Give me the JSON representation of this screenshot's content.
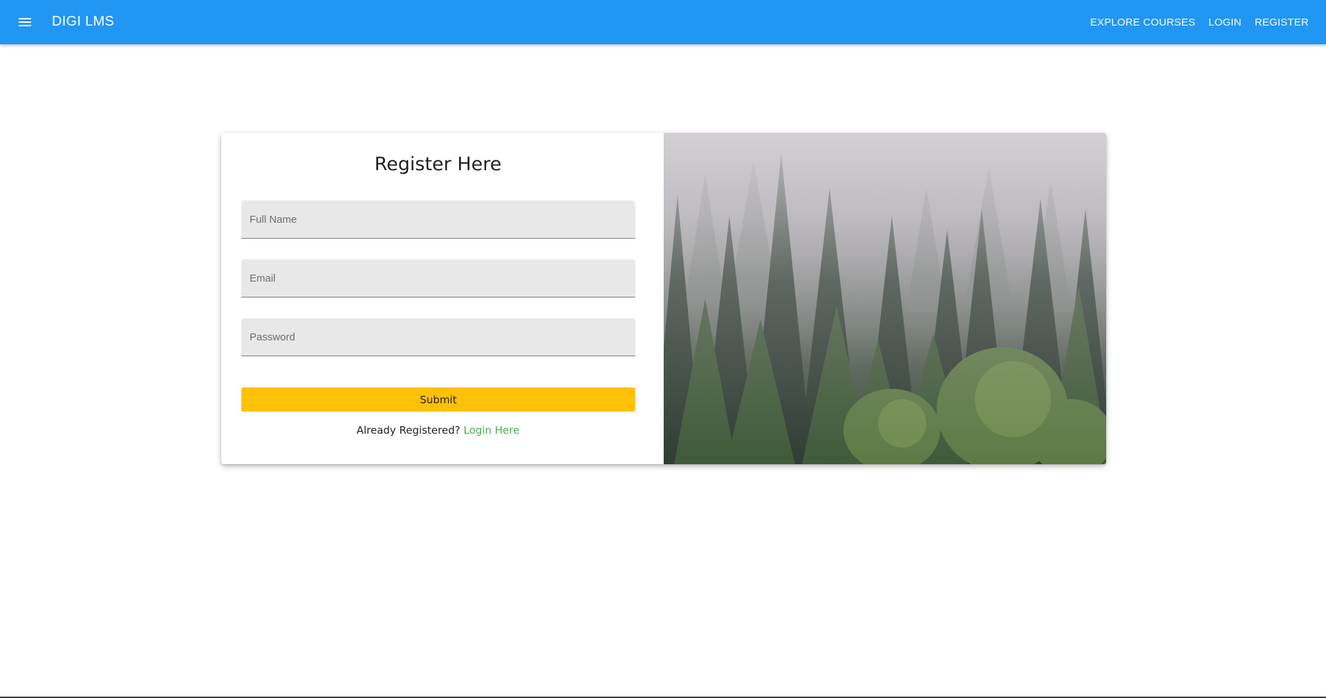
{
  "appbar": {
    "menu_icon": "menu-icon",
    "brand": "DIGI LMS",
    "nav": [
      {
        "label": "EXPLORE COURSES"
      },
      {
        "label": "LOGIN"
      },
      {
        "label": "REGISTER"
      }
    ],
    "color": "#2196f3"
  },
  "register": {
    "title": "Register Here",
    "fields": {
      "full_name": {
        "placeholder": "Full Name",
        "value": ""
      },
      "email": {
        "placeholder": "Email",
        "value": ""
      },
      "password": {
        "placeholder": "Password",
        "value": ""
      }
    },
    "submit_label": "Submit",
    "submit_color": "#ffc107",
    "already_text": "Already Registered?",
    "login_link": "Login Here",
    "login_link_color": "#4caf50"
  },
  "hero_image": {
    "description_icon": "forest-photo"
  }
}
